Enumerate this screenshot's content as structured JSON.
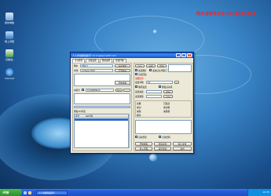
{
  "desktop": {
    "contact_text": "购买请联系QQ:1016983818",
    "icons": [
      {
        "name": "mycomputer-desktop-icon",
        "label": "我的电脑"
      },
      {
        "name": "network-desktop-icon",
        "label": "网上邻居"
      },
      {
        "name": "recycle-desktop-icon",
        "label": "回收站"
      },
      {
        "name": "ie-desktop-icon",
        "label": "Internet"
      }
    ]
  },
  "window": {
    "title": "人人商城群发助手 v1.0  www.rrsoft.com",
    "tabs": [
      "主功能区",
      "高级设置",
      "帮助说明",
      "在线升级"
    ],
    "left": {
      "url_label": "网址",
      "url_value": "http://",
      "find_label": "查找",
      "find_value": "Acdsee 2010",
      "browse_button": "浏览网页",
      "open_button": "打开网址",
      "search_button": "开始搜索",
      "stop_button": "停止",
      "keyword_label": "关键字",
      "keyword_value": "1310483613",
      "list_title": "群发QQ列表",
      "list_headers": [
        "序号",
        "QQ号码"
      ],
      "progress_label": "状态:"
    },
    "right": {
      "row1": [
        "自动",
        "分组",
        "添加"
      ],
      "options": [
        "发送图片",
        "发送后关闭窗口",
        "自动回复",
        "发送间隔"
      ],
      "hint_red": "温馨提示:",
      "interval_label": "发送间隔",
      "interval_value": "10",
      "check_a": "随机发送",
      "check_b": "群发后关机",
      "field_labels": [
        "发送速度",
        "发送数量",
        "已发送",
        "成功数",
        "失败数"
      ],
      "stat_labels": [
        "总数:",
        "成功:",
        "失败:",
        "剩余:"
      ],
      "bottom_checks": [
        "自动登录",
        "记住密码"
      ],
      "buttons": [
        "开始群发",
        "暂停发送",
        "停止发送",
        "导入号码",
        "清空列表",
        "退出"
      ]
    }
  },
  "taskbar": {
    "start_label": "开始",
    "task_label": "人人商城群发助手",
    "clock": "19:35"
  }
}
